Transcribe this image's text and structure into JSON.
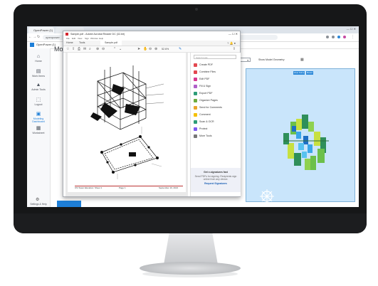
{
  "browser": {
    "tabs": [
      "OpenPower (1)",
      "Sample.pdf - Adobe Acrobat Reader DC (32-bit)"
    ],
    "address_value": "openpower",
    "window_controls": [
      "—",
      "☐",
      "✕"
    ]
  },
  "app": {
    "brand": "OpenPower (1)",
    "title": "Mo",
    "sidebar": [
      {
        "label": "Home",
        "icon": "home-icon"
      },
      {
        "label": "Work Items",
        "icon": "briefcase-icon"
      },
      {
        "label": "Admin Tools",
        "icon": "tools-icon"
      },
      {
        "label": "Logout",
        "icon": "logout-icon"
      },
      {
        "label": "Modeling Dashboard",
        "icon": "model-icon"
      },
      {
        "label": "Worksheet",
        "icon": "worksheet-icon"
      }
    ],
    "settings_label": "Settings & Help",
    "model_dropdown": "▾",
    "model_label": "Show Model Geometry",
    "viewer_buttons": [
      "View Solve",
      "Reset"
    ]
  },
  "acrobat": {
    "title": "Sample.pdf - Adobe Acrobat Reader DC (32-bit)",
    "menu": [
      "File",
      "Edit",
      "View",
      "Sign",
      "Window",
      "Help"
    ],
    "tabs": [
      "Home",
      "Tools",
      "Sample.pdf"
    ],
    "zoom": "52.6%",
    "search_placeholder": "Search tools",
    "tools": [
      {
        "label": "Create PDF",
        "color": "#e34850"
      },
      {
        "label": "Combine Files",
        "color": "#e34850"
      },
      {
        "label": "Edit PDF",
        "color": "#d83790"
      },
      {
        "label": "Fill & Sign",
        "color": "#b160c8"
      },
      {
        "label": "Export PDF",
        "color": "#2d9d78"
      },
      {
        "label": "Organize Pages",
        "color": "#6cab3e"
      },
      {
        "label": "Send for Comments",
        "color": "#e9a52c"
      },
      {
        "label": "Comment",
        "color": "#f5c000"
      },
      {
        "label": "Scan & OCR",
        "color": "#2d9d78"
      },
      {
        "label": "Protect",
        "color": "#7f5af0"
      },
      {
        "label": "More Tools",
        "color": "#777777"
      }
    ],
    "promo_title": "Get e-signatures fast",
    "promo_text": "Send PDFs for signing. Recipients sign online from any device.",
    "promo_link": "Request Signatures",
    "footer_left": "OS Tower Elevation: Sheet 1",
    "footer_mid": "Page 1",
    "footer_right": "September 10, 2021"
  }
}
